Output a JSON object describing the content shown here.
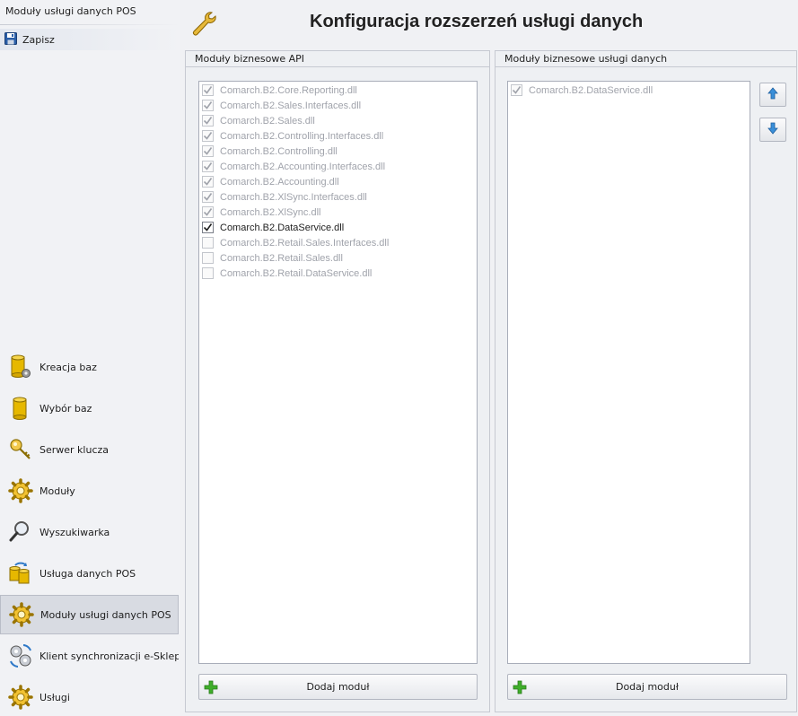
{
  "sidebar": {
    "title": "Moduły usługi danych POS",
    "save_label": "Zapisz",
    "items": [
      {
        "label": "Kreacja baz",
        "icon": "database-gear-icon"
      },
      {
        "label": "Wybór baz",
        "icon": "database-icon"
      },
      {
        "label": "Serwer klucza",
        "icon": "key-icon"
      },
      {
        "label": "Moduły",
        "icon": "gear-icon"
      },
      {
        "label": "Wyszukiwarka",
        "icon": "magnifier-icon"
      },
      {
        "label": "Usługa danych POS",
        "icon": "database-sync-icon"
      },
      {
        "label": "Moduły usługi danych POS",
        "icon": "gear-icon"
      },
      {
        "label": "Klient synchronizacji e-Sklep/wsz",
        "icon": "gears-sync-icon"
      },
      {
        "label": "Usługi",
        "icon": "gear-icon"
      }
    ],
    "active_index": 6
  },
  "header": {
    "title": "Konfiguracja rozszerzeń usługi danych",
    "icon": "wrench-icon"
  },
  "left_panel": {
    "title": "Moduły biznesowe API",
    "modules": [
      {
        "name": "Comarch.B2.Core.Reporting.dll",
        "checked": true,
        "enabled": false
      },
      {
        "name": "Comarch.B2.Sales.Interfaces.dll",
        "checked": true,
        "enabled": false
      },
      {
        "name": "Comarch.B2.Sales.dll",
        "checked": true,
        "enabled": false
      },
      {
        "name": "Comarch.B2.Controlling.Interfaces.dll",
        "checked": true,
        "enabled": false
      },
      {
        "name": "Comarch.B2.Controlling.dll",
        "checked": true,
        "enabled": false
      },
      {
        "name": "Comarch.B2.Accounting.Interfaces.dll",
        "checked": true,
        "enabled": false
      },
      {
        "name": "Comarch.B2.Accounting.dll",
        "checked": true,
        "enabled": false
      },
      {
        "name": "Comarch.B2.XlSync.Interfaces.dll",
        "checked": true,
        "enabled": false
      },
      {
        "name": "Comarch.B2.XlSync.dll",
        "checked": true,
        "enabled": false
      },
      {
        "name": "Comarch.B2.DataService.dll",
        "checked": true,
        "enabled": true
      },
      {
        "name": "Comarch.B2.Retail.Sales.Interfaces.dll",
        "checked": false,
        "enabled": false
      },
      {
        "name": "Comarch.B2.Retail.Sales.dll",
        "checked": false,
        "enabled": false
      },
      {
        "name": "Comarch.B2.Retail.DataService.dll",
        "checked": false,
        "enabled": false
      }
    ],
    "add_label": "Dodaj moduł"
  },
  "right_panel": {
    "title": "Moduły biznesowe usługi danych",
    "modules": [
      {
        "name": "Comarch.B2.DataService.dll",
        "checked": true,
        "enabled": false
      }
    ],
    "add_label": "Dodaj moduł"
  },
  "colors": {
    "accent_blue": "#2f79c8",
    "plus_green": "#3fae2a",
    "gold": "#e4b400"
  }
}
